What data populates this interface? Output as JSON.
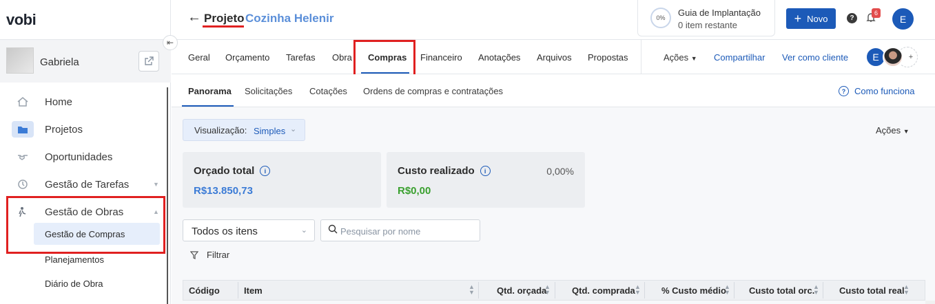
{
  "sidebar": {
    "logo": "vobi",
    "company_name": "Gabriela",
    "nav": [
      {
        "label": "Home",
        "icon": "home-icon"
      },
      {
        "label": "Projetos",
        "icon": "folder-icon"
      },
      {
        "label": "Oportunidades",
        "icon": "handshake-icon"
      },
      {
        "label": "Gestão de Tarefas",
        "icon": "clock-icon"
      },
      {
        "label": "Gestão de Obras",
        "icon": "worker-icon"
      }
    ],
    "sub_items": [
      "Gestão de Compras",
      "Planejamentos",
      "Diário de Obra"
    ]
  },
  "header": {
    "project_prefix": "Projeto",
    "project_name": "Cozinha Helenir",
    "guide_percent": "0%",
    "guide_title": "Guia de Implantação",
    "guide_sub": "0 item restante",
    "new_label": "Novo",
    "notifications": "6",
    "avatar_initial": "E"
  },
  "tabs": [
    "Geral",
    "Orçamento",
    "Tarefas",
    "Obra",
    "Compras",
    "Financeiro",
    "Anotações",
    "Arquivos",
    "Propostas"
  ],
  "tab_actions": {
    "acoes": "Ações",
    "share": "Compartilhar",
    "client_view": "Ver como cliente",
    "share_avatar": "E",
    "plus": "+"
  },
  "subtabs": [
    "Panorama",
    "Solicitações",
    "Cotações",
    "Ordens de compras e contratações"
  ],
  "how_it_works": "Como funciona",
  "view": {
    "label": "Visualização:",
    "value": "Simples"
  },
  "acoes_right": "Ações",
  "cards": {
    "budget_title": "Orçado total",
    "budget_value": "R$13.850,73",
    "cost_title": "Custo realizado",
    "cost_value": "R$0,00",
    "cost_pct": "0,00%"
  },
  "filters": {
    "items_select": "Todos os itens",
    "search_placeholder": "Pesquisar por nome",
    "filter_label": "Filtrar"
  },
  "table": {
    "columns": [
      "Código",
      "Item",
      "Qtd. orçada",
      "Qtd. comprada",
      "% Custo médio",
      "Custo total orc.",
      "Custo total real"
    ]
  },
  "colors": {
    "accent": "#1c5ab8",
    "link_blue": "#5b8fd9",
    "highlight_red": "#e02020",
    "money_green": "#3aa02f"
  }
}
